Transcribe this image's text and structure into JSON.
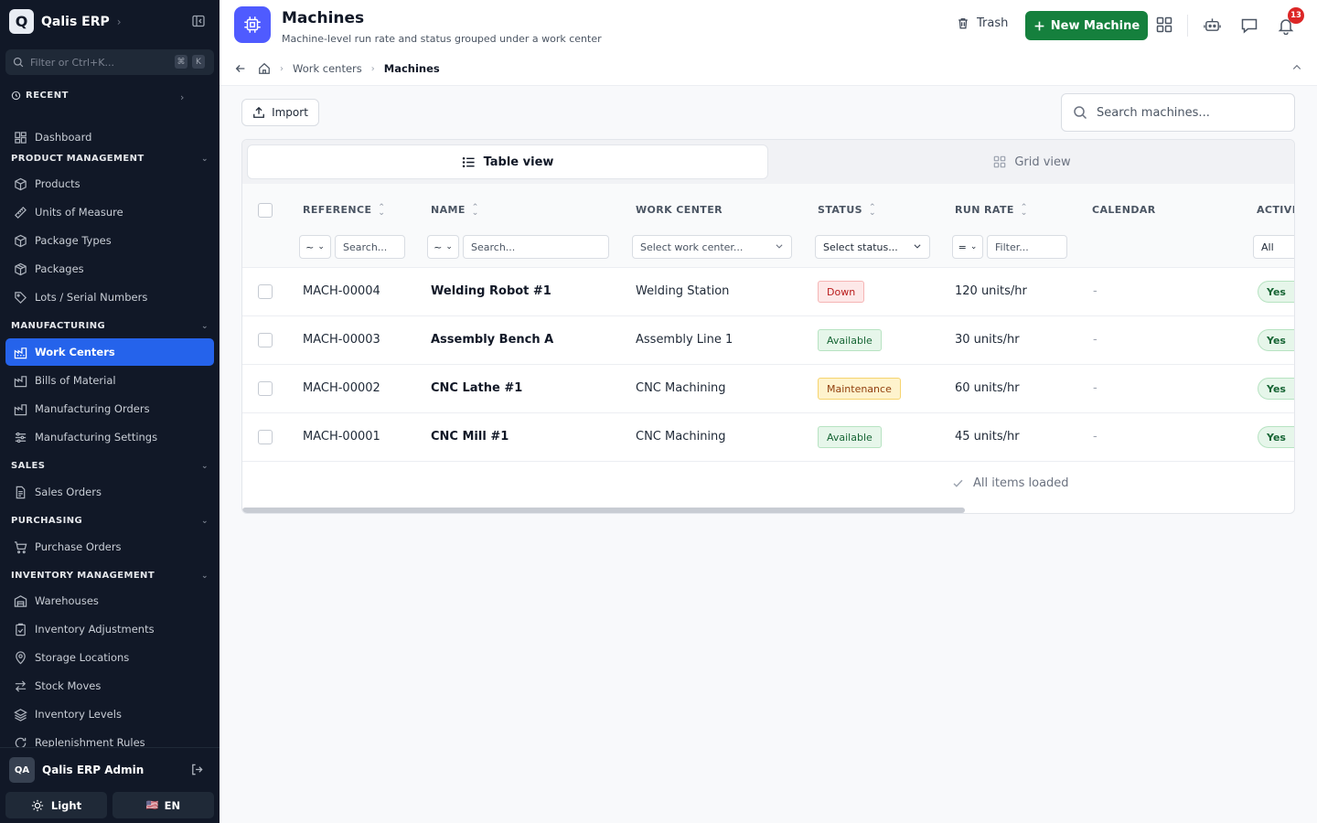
{
  "sidebar": {
    "brand": {
      "logo_letter": "Q",
      "name": "Qalis ERP"
    },
    "filter": {
      "placeholder": "Filter or Ctrl+K...",
      "kbd": [
        "⌘",
        "K"
      ]
    },
    "recent_label": "RECENT",
    "dashboard": "Dashboard",
    "sections": [
      {
        "label": "PRODUCT MANAGEMENT",
        "items": [
          "Products",
          "Units of Measure",
          "Package Types",
          "Packages",
          "Lots / Serial Numbers"
        ]
      },
      {
        "label": "MANUFACTURING",
        "items": [
          "Work Centers",
          "Bills of Material",
          "Manufacturing Orders",
          "Manufacturing Settings"
        ]
      },
      {
        "label": "SALES",
        "items": [
          "Sales Orders"
        ]
      },
      {
        "label": "PURCHASING",
        "items": [
          "Purchase Orders"
        ]
      },
      {
        "label": "INVENTORY MANAGEMENT",
        "items": [
          "Warehouses",
          "Inventory Adjustments",
          "Storage Locations",
          "Stock Moves",
          "Inventory Levels",
          "Replenishment Rules"
        ]
      }
    ],
    "active_item": "Work Centers",
    "user": {
      "initials": "QA",
      "name": "Qalis ERP Admin"
    },
    "theme_label": "Light",
    "lang_label": "EN",
    "lang_flag": "🇺🇸"
  },
  "header": {
    "title": "Machines",
    "subtitle": "Machine-level run rate and status grouped under a work center",
    "trash_label": "Trash",
    "new_button_label": "New Machine",
    "notification_count": "13",
    "breadcrumbs": [
      "Work centers",
      "Machines"
    ]
  },
  "toolbar": {
    "import_label": "Import",
    "search_placeholder": "Search machines..."
  },
  "views": {
    "table": "Table view",
    "grid": "Grid view"
  },
  "table": {
    "columns": {
      "reference": "REFERENCE",
      "name": "NAME",
      "work_center": "WORK CENTER",
      "status": "STATUS",
      "run_rate": "RUN RATE",
      "calendar": "CALENDAR",
      "active": "ACTIVE"
    },
    "filters": {
      "op_default": "~",
      "search_placeholder": "Search...",
      "work_center_placeholder": "Select work center...",
      "status_placeholder": "Select status...",
      "run_rate_op": "=",
      "run_rate_placeholder": "Filter...",
      "active_value": "All"
    },
    "rows": [
      {
        "reference": "MACH-00004",
        "name": "Welding Robot #1",
        "work_center": "Welding Station",
        "status": "Down",
        "status_kind": "down",
        "run_rate": "120 units/hr",
        "calendar": "-",
        "active": "Yes"
      },
      {
        "reference": "MACH-00003",
        "name": "Assembly Bench A",
        "work_center": "Assembly Line 1",
        "status": "Available",
        "status_kind": "avail",
        "run_rate": "30 units/hr",
        "calendar": "-",
        "active": "Yes"
      },
      {
        "reference": "MACH-00002",
        "name": "CNC Lathe #1",
        "work_center": "CNC Machining",
        "status": "Maintenance",
        "status_kind": "maint",
        "run_rate": "60 units/hr",
        "calendar": "-",
        "active": "Yes"
      },
      {
        "reference": "MACH-00001",
        "name": "CNC Mill #1",
        "work_center": "CNC Machining",
        "status": "Available",
        "status_kind": "avail",
        "run_rate": "45 units/hr",
        "calendar": "-",
        "active": "Yes"
      }
    ],
    "footer_text": "All items loaded"
  },
  "colors": {
    "sidebar_bg": "#111827",
    "accent": "#2563eb",
    "primary_button": "#15803d",
    "page_icon": "#4f5bff",
    "notification": "#dc2626"
  },
  "icons": {
    "page": "cpu-icon",
    "trash": "trash-icon",
    "new": "plus-icon",
    "apps": "grid-icon",
    "robot": "robot-icon",
    "chat": "chat-icon",
    "notifications": "bell-icon"
  }
}
